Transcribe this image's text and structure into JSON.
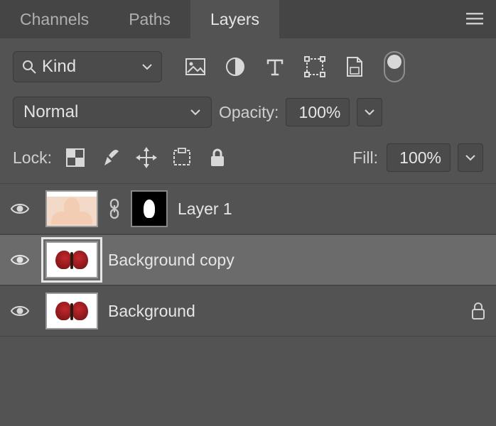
{
  "tabs": {
    "channels": "Channels",
    "paths": "Paths",
    "layers": "Layers"
  },
  "filter": {
    "kind_label": "Kind",
    "icons": [
      "image",
      "adjustment",
      "type",
      "shape",
      "smartobject"
    ]
  },
  "blend": {
    "mode": "Normal",
    "opacity_label": "Opacity:",
    "opacity_value": "100%"
  },
  "lock": {
    "label": "Lock:",
    "fill_label": "Fill:",
    "fill_value": "100%"
  },
  "layers": [
    {
      "name": "Layer 1",
      "visible": true,
      "selected": false,
      "thumb": "face",
      "has_mask": true,
      "linked": true,
      "locked": false
    },
    {
      "name": "Background copy",
      "visible": true,
      "selected": true,
      "thumb": "butterfly",
      "has_mask": false,
      "linked": false,
      "locked": false
    },
    {
      "name": "Background",
      "visible": true,
      "selected": false,
      "thumb": "butterfly",
      "has_mask": false,
      "linked": false,
      "locked": true
    }
  ]
}
